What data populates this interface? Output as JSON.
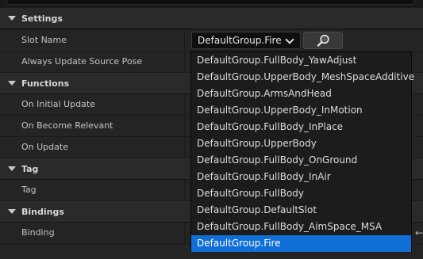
{
  "categories": {
    "settings": "Settings",
    "functions": "Functions",
    "tag": "Tag",
    "bindings": "Bindings"
  },
  "properties": {
    "slot_name": "Slot Name",
    "always_update_source_pose": "Always Update Source Pose",
    "on_initial_update": "On Initial Update",
    "on_become_relevant": "On Become Relevant",
    "on_update": "On Update",
    "tag": "Tag",
    "binding": "Binding"
  },
  "slot_combo": {
    "value": "DefaultGroup.Fire"
  },
  "dropdown": {
    "options": [
      "DefaultGroup.FullBody_YawAdjust",
      "DefaultGroup.UpperBody_MeshSpaceAdditive",
      "DefaultGroup.ArmsAndHead",
      "DefaultGroup.UpperBody_InMotion",
      "DefaultGroup.FullBody_InPlace",
      "DefaultGroup.UpperBody",
      "DefaultGroup.FullBody_OnGround",
      "DefaultGroup.FullBody_InAir",
      "DefaultGroup.FullBody",
      "DefaultGroup.DefaultSlot",
      "DefaultGroup.FullBody_AimSpace_MSA",
      "DefaultGroup.Fire"
    ],
    "selected_index": 11
  },
  "icons": {
    "browse": "magnifier-icon",
    "category_toggle": "triangle-down-icon",
    "combo_toggle": "chevron-down-icon",
    "binding_arrow": "arrow-left-icon"
  },
  "colors": {
    "selected_highlight": "#0f6fd6",
    "panel_background": "#242424",
    "category_background": "#2a2a2a",
    "dropdown_background": "#1c1c1c"
  }
}
